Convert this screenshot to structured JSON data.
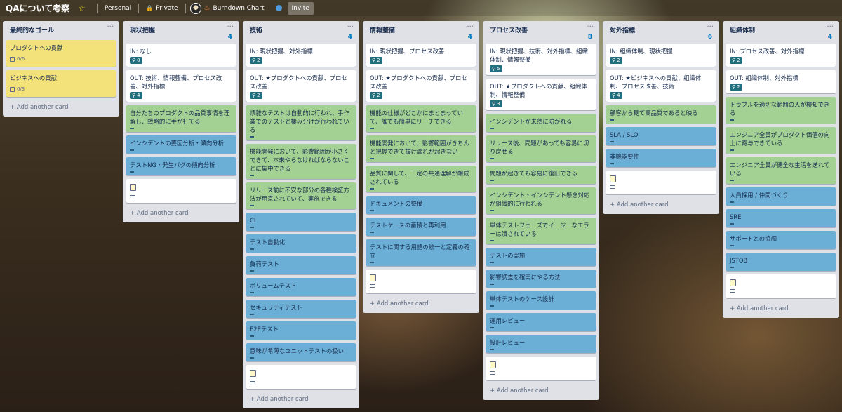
{
  "header": {
    "board_title": "QAについて考察",
    "workspace": "Personal",
    "visibility": "Private",
    "powerup": "Burndown Chart",
    "invite": "Invite"
  },
  "add_card_label": "+ Add another card",
  "lists": [
    {
      "title": "最終的なゴール",
      "count": "",
      "cards": [
        {
          "text": "プロダクトへの貢献",
          "color": "yellow",
          "checklist": "0/6"
        },
        {
          "text": "ビジネスへの貢献",
          "color": "yellow",
          "checklist": "0/3"
        }
      ]
    },
    {
      "title": "現状把握",
      "count": "4",
      "cards": [
        {
          "text": "IN: なし",
          "color": "white",
          "badge": "0"
        },
        {
          "text": "OUT: 技術、情報整備、プロセス改善、対外指標",
          "color": "white",
          "badge": "4"
        },
        {
          "text": "自分たちのプロダクトの品質事情を理解し、戦略的に手が打てる",
          "color": "green"
        },
        {
          "text": "インシデントの要因分析・傾向分析",
          "color": "blue"
        },
        {
          "text": "テストNG・発生バグの傾向分析",
          "color": "blue"
        },
        {
          "text": "",
          "color": "white",
          "empty": true
        }
      ]
    },
    {
      "title": "技術",
      "count": "4",
      "cards": [
        {
          "text": "IN: 現状把握、対外指標",
          "color": "white",
          "badge": "2"
        },
        {
          "text": "OUT: ★プロダクトへの貢献、プロセス改善",
          "color": "white",
          "badge": "2"
        },
        {
          "text": "煩雑なテストは自動的に行われ、手作業でのテストと棲み分けが行われている",
          "color": "green"
        },
        {
          "text": "機能開発において、影響範囲が小さくできて、本来やらなければならないことに集中できる",
          "color": "green"
        },
        {
          "text": "リリース前に不安な部分の各種検証方法が用意されていて、実施できる",
          "color": "green"
        },
        {
          "text": "CI",
          "color": "blue"
        },
        {
          "text": "テスト自動化",
          "color": "blue"
        },
        {
          "text": "負荷テスト",
          "color": "blue"
        },
        {
          "text": "ボリュームテスト",
          "color": "blue"
        },
        {
          "text": "セキュリティテスト",
          "color": "blue"
        },
        {
          "text": "E2Eテスト",
          "color": "blue"
        },
        {
          "text": "意味が希薄なユニットテストの扱い",
          "color": "blue"
        },
        {
          "text": "",
          "color": "white",
          "empty": true
        }
      ]
    },
    {
      "title": "情報整備",
      "count": "4",
      "cards": [
        {
          "text": "IN: 現状把握、プロセス改善",
          "color": "white",
          "badge": "2"
        },
        {
          "text": "OUT: ★プロダクトへの貢献、プロセス改善",
          "color": "white",
          "badge": "2"
        },
        {
          "text": "機能の仕様がどこかにまとまっていて、誰でも簡単にリーチできる",
          "color": "green"
        },
        {
          "text": "機能開発において、影響範囲がきちんと把握できて抜け漏れが起きない",
          "color": "green"
        },
        {
          "text": "品質に関して、一定の共通理解が醸成されている",
          "color": "green"
        },
        {
          "text": "ドキュメントの整備",
          "color": "blue"
        },
        {
          "text": "テストケースの蓄積と再利用",
          "color": "blue"
        },
        {
          "text": "テストに関する用語の統一と定義の確立",
          "color": "blue"
        },
        {
          "text": "",
          "color": "white",
          "empty": true
        }
      ]
    },
    {
      "title": "プロセス改善",
      "count": "8",
      "cards": [
        {
          "text": "IN: 現状把握、技術、対外指標、組織体制、情報整備",
          "color": "white",
          "badge": "5"
        },
        {
          "text": "OUT: ★プロダクトへの貢献、組織体制、情報整備",
          "color": "white",
          "badge": "3"
        },
        {
          "text": "インシデントが未然に防がれる",
          "color": "green"
        },
        {
          "text": "リリース後、問題があっても容易に切り戻せる",
          "color": "green"
        },
        {
          "text": "問題が起きても容易に復旧できる",
          "color": "green"
        },
        {
          "text": "インシデント・インシデント懸念対応が組織的に行われる",
          "color": "green"
        },
        {
          "text": "単体テストフェーズでイージーなエラーは潰されている",
          "color": "green"
        },
        {
          "text": "テストの実施",
          "color": "blue"
        },
        {
          "text": "影響調査を確実にやる方法",
          "color": "blue"
        },
        {
          "text": "単体テストのケース設計",
          "color": "blue"
        },
        {
          "text": "運用レビュー",
          "color": "blue"
        },
        {
          "text": "設計レビュー",
          "color": "blue"
        },
        {
          "text": "",
          "color": "white",
          "empty": true
        }
      ]
    },
    {
      "title": "対外指標",
      "count": "6",
      "cards": [
        {
          "text": "IN: 組織体制、現状把握",
          "color": "white",
          "badge": "2"
        },
        {
          "text": "OUT: ★ビジネスへの貢献、組織体制、プロセス改善、技術",
          "color": "white",
          "badge": "4"
        },
        {
          "text": "顧客から見て高品質であると映る",
          "color": "green"
        },
        {
          "text": "SLA / SLO",
          "color": "blue"
        },
        {
          "text": "非機能要件",
          "color": "blue"
        },
        {
          "text": "",
          "color": "white",
          "empty": true
        }
      ]
    },
    {
      "title": "組織体制",
      "count": "4",
      "cards": [
        {
          "text": "IN: プロセス改善、対外指標",
          "color": "white",
          "badge": "2"
        },
        {
          "text": "OUT: 組織体制、対外指標",
          "color": "white",
          "badge": "2"
        },
        {
          "text": "トラブルを適切な範囲の人が検知できる",
          "color": "green"
        },
        {
          "text": "エンジニア全員がプロダクト価値の向上に寄与できている",
          "color": "green"
        },
        {
          "text": "エンジニア全員が健全な生活を送れている",
          "color": "green"
        },
        {
          "text": "人員採用 / 仲間づくり",
          "color": "blue"
        },
        {
          "text": "SRE",
          "color": "blue"
        },
        {
          "text": "サポートとの協調",
          "color": "blue"
        },
        {
          "text": "JSTQB",
          "color": "blue"
        },
        {
          "text": "",
          "color": "white",
          "empty": true
        }
      ]
    }
  ]
}
